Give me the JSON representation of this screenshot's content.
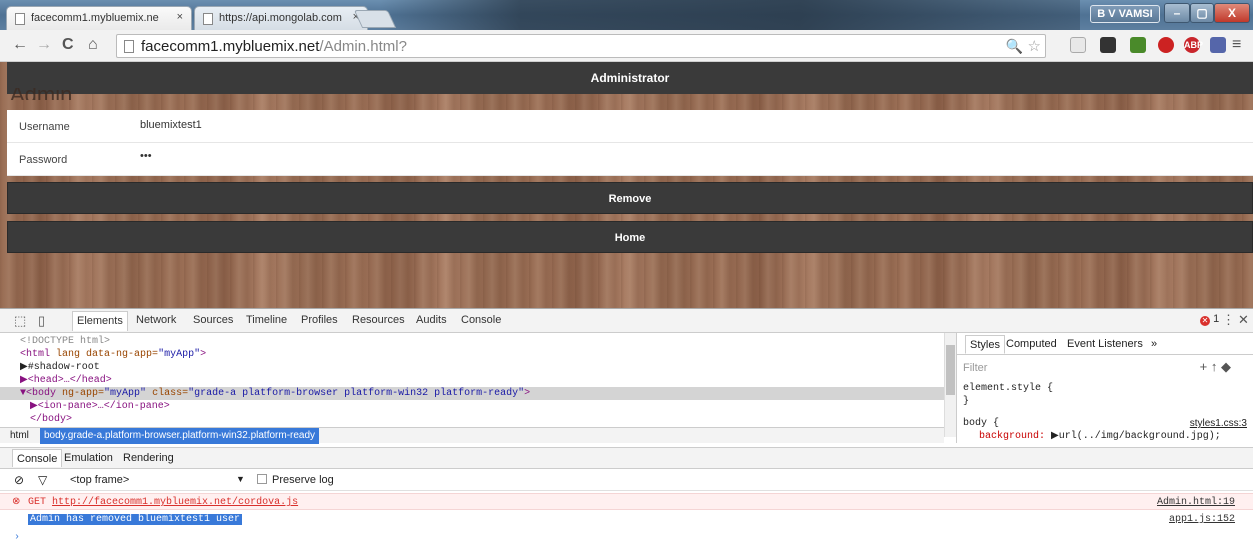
{
  "browser": {
    "tabs": [
      {
        "title": "facecomm1.mybluemix.ne",
        "active": true
      },
      {
        "title": "https://api.mongolab.com",
        "active": false
      }
    ],
    "close_glyph": "×",
    "user_badge": "B V VAMSI",
    "window_buttons": {
      "minimize": "–",
      "maximize": "▢",
      "close": "X"
    },
    "nav": {
      "back": "←",
      "forward": "→",
      "reload": "C",
      "home": "⌂"
    },
    "url_host": "facecomm1.mybluemix.net",
    "url_path": "/Admin.html?",
    "extensions": [
      {
        "name": "meet-icon",
        "label": "",
        "color": "#e8e8e8"
      },
      {
        "name": "extension-red-icon",
        "label": "",
        "color": "#333333"
      },
      {
        "name": "check-icon",
        "label": "",
        "color": "#4a8a2a"
      },
      {
        "name": "power-icon",
        "label": "",
        "color": "#cc2222"
      },
      {
        "name": "abp-icon",
        "label": "ABP",
        "color": "#c9262c"
      },
      {
        "name": "flag-icon",
        "label": "",
        "color": "#5566aa"
      }
    ],
    "menu_glyph": "≡"
  },
  "page": {
    "header": "Administrator",
    "ghost_title": "Admin",
    "username_label": "Username",
    "username_value": "bluemixtest1",
    "password_label": "Password",
    "password_value": "•••",
    "remove_label": "Remove",
    "home_label": "Home"
  },
  "devtools": {
    "tabs": [
      "Elements",
      "Network",
      "Sources",
      "Timeline",
      "Profiles",
      "Resources",
      "Audits",
      "Console"
    ],
    "active_tab": "Elements",
    "error_count": "1",
    "dom": {
      "doctype": "<!DOCTYPE html>",
      "html_open_tag": "<html",
      "html_attr": "lang data-ng-app=",
      "html_attr_val": "\"myApp\"",
      "html_close": ">",
      "shadow_root": "▶#shadow-root",
      "head": "▶<head>…</head>",
      "body_tag": "▼<body",
      "body_attr1": "ng-app=",
      "body_attr1_val": "\"myApp\"",
      "body_attr2": "class=",
      "body_attr2_val": "\"grade-a platform-browser platform-win32 platform-ready\"",
      "body_close": ">",
      "ion_pane": "▶<ion-pane>…</ion-pane>",
      "body_end": "</body>"
    },
    "breadcrumb": [
      "html",
      "body.grade-a.platform-browser.platform-win32.platform-ready"
    ],
    "styles_tabs": [
      "Styles",
      "Computed",
      "Event Listeners",
      "»"
    ],
    "styles_filter": "Filter",
    "styles_code": {
      "element_style": "element.style {",
      "close_brace": "}",
      "body_rule": "body {",
      "background_prop": "background:",
      "background_val": "▶url(../img/background.jpg);",
      "source": "styles1.css:3"
    },
    "drawer_tabs": [
      "Console",
      "Emulation",
      "Rendering"
    ],
    "console_filter": {
      "frame": "<top frame>",
      "preserve_log": "Preserve log"
    },
    "console": [
      {
        "type": "error",
        "prefix": "GET",
        "url": "http://facecomm1.mybluemix.net/cordova.js",
        "source": "Admin.html:19"
      },
      {
        "type": "log",
        "text": "Admin  has removed bluemixtest1 user",
        "source": "app1.js:152"
      }
    ],
    "prompt": "›"
  }
}
